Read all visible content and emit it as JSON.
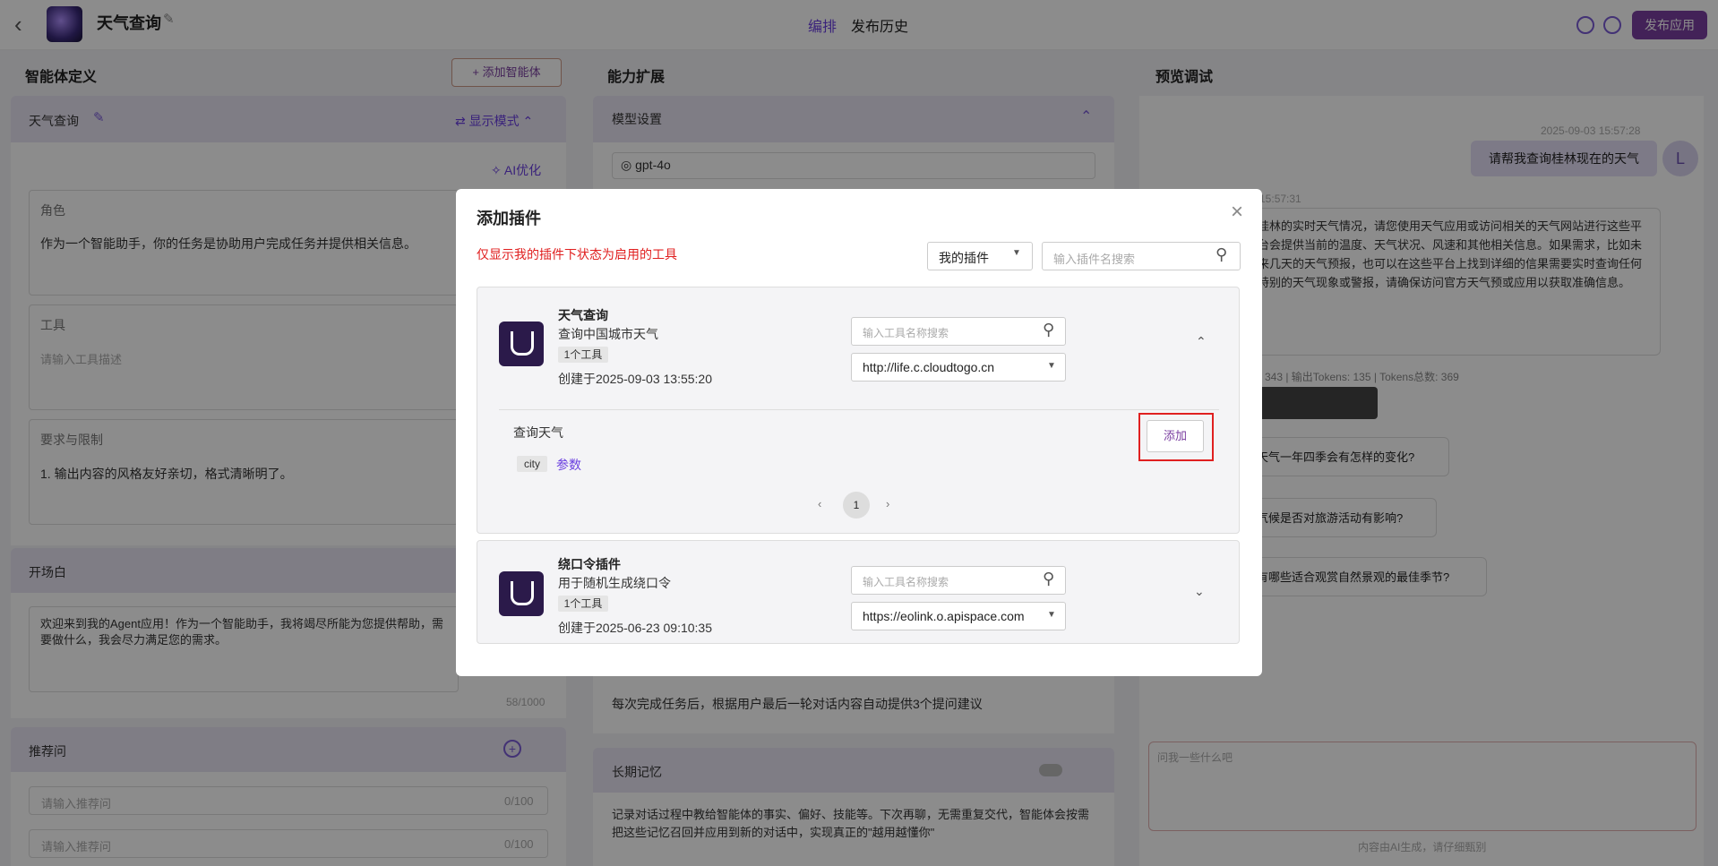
{
  "header": {
    "app_title": "天气查询",
    "tabs": [
      "编排",
      "发布历史"
    ],
    "publish_label": "发布应用"
  },
  "left": {
    "title": "智能体定义",
    "add_agent_label": "添加智能体",
    "agent_name": "天气查询",
    "display_mode": "显示模式",
    "ai_optimize": "AI优化",
    "role_label": "角色",
    "role_text": "作为一个智能助手，你的任务是协助用户完成任务并提供相关信息。",
    "tools_label": "工具",
    "tools_placeholder": "请输入工具描述",
    "requirements_label": "要求与限制",
    "requirements_text": "1. 输出内容的风格友好亲切，格式清晰明了。",
    "opening_label": "开场白",
    "opening_text": "欢迎来到我的Agent应用！作为一个智能助手，我将竭尽所能为您提供帮助，需要做什么，我会尽力满足您的需求。",
    "opening_count": "58/1000",
    "suggest_label": "推荐问",
    "suggest_placeholder": "请输入推荐问",
    "suggest_count": "0/100"
  },
  "middle": {
    "title": "能力扩展",
    "model_settings": "模型设置",
    "model": "gpt-4o",
    "followup_text": "每次完成任务后，根据用户最后一轮对话内容自动提供3个提问建议",
    "memory_label": "长期记忆",
    "memory_text": "记录对话过程中教给智能体的事实、偏好、技能等。下次再聊，无需重复交代，智能体会按需把这些记忆召回并应用到新的对话中，实现真正的\"越用越懂你\""
  },
  "right": {
    "title": "预览调试",
    "user_time": "2025-09-03 15:57:28",
    "user_msg": "请帮我查询桂林现在的天气",
    "avatar": "L",
    "bot_time": "3 15:57:31",
    "bot_msg": "桂林的实时天气情况，请您使用天气应用或访问相关的天气网站进行这些平台会提供当前的温度、天气状况、风速和其他相关信息。如果需求，比如未来几天的天气预报，也可以在这些平台上找到详细的信果需要实时查询任何特别的天气现象或警报，请确保访问官方天气预或应用以获取准确信息。",
    "tokens": "343 | 输出Tokens: 135 | Tokens总数: 369",
    "suggestions": [
      "天气一年四季会有怎样的变化?",
      "气候是否对旅游活动有影响?",
      "有哪些适合观赏自然景观的最佳季节?"
    ],
    "input_placeholder": "问我一些什么吧",
    "footer": "内容由AI生成，请仔细甄别"
  },
  "modal": {
    "title": "添加插件",
    "notice": "仅显示我的插件下状态为启用的工具",
    "filter": "我的插件",
    "search_placeholder": "输入插件名搜索",
    "plugins": [
      {
        "name": "天气查询",
        "desc": "查询中国城市天气",
        "tool_count": "1个工具",
        "created": "创建于2025-09-03 13:55:20",
        "tool_search_placeholder": "输入工具名称搜索",
        "url": "http://life.c.cloudtogo.cn",
        "tool_name": "查询天气",
        "param_tag": "city",
        "param_link": "参数",
        "add_label": "添加",
        "page": "1"
      },
      {
        "name": "绕口令插件",
        "desc": "用于随机生成绕口令",
        "tool_count": "1个工具",
        "created": "创建于2025-06-23 09:10:35",
        "tool_search_placeholder": "输入工具名称搜索",
        "url": "https://eolink.o.apispace.com"
      }
    ]
  }
}
